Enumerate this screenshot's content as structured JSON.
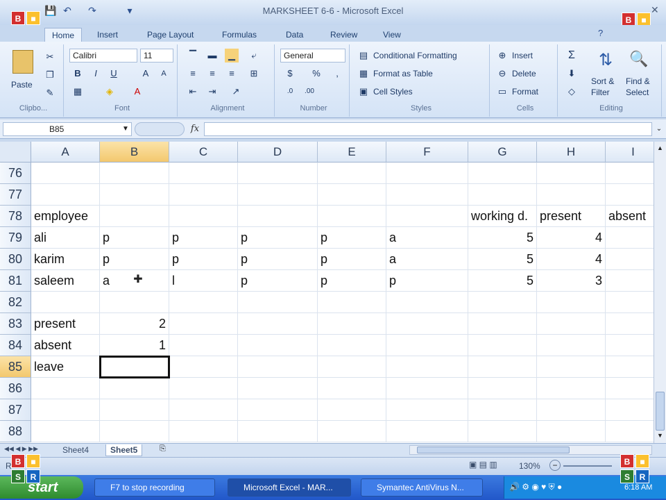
{
  "window": {
    "title": "MARKSHEET 6-6 - Microsoft Excel"
  },
  "ribbon_tabs": [
    "Home",
    "Insert",
    "Page Layout",
    "Formulas",
    "Data",
    "Review",
    "View"
  ],
  "ribbon": {
    "clipboard": {
      "paste": "Paste",
      "group": "Clipbo..."
    },
    "font": {
      "name": "Calibri",
      "size": "11",
      "group": "Font",
      "bold": "B",
      "italic": "I",
      "underline": "U"
    },
    "alignment": {
      "group": "Alignment"
    },
    "number": {
      "format": "General",
      "group": "Number",
      "currency": "$",
      "percent": "%"
    },
    "styles": {
      "conditional": "Conditional Formatting",
      "table": "Format as Table",
      "cell": "Cell Styles",
      "group": "Styles"
    },
    "cells": {
      "insert": "Insert",
      "delete": "Delete",
      "format": "Format",
      "group": "Cells"
    },
    "editing": {
      "sigma": "Σ",
      "sort": "Sort &",
      "sort2": "Filter",
      "find": "Find &",
      "find2": "Select",
      "group": "Editing"
    }
  },
  "formula_bar": {
    "name_box": "B85",
    "fx": "fx",
    "formula": ""
  },
  "columns": [
    "A",
    "B",
    "C",
    "D",
    "E",
    "F",
    "G",
    "H",
    "I"
  ],
  "selected_column": "B",
  "selected_row": "85",
  "rows": [
    {
      "num": "76",
      "cells": [
        "",
        "",
        "",
        "",
        "",
        "",
        "",
        "",
        ""
      ]
    },
    {
      "num": "77",
      "cells": [
        "",
        "",
        "",
        "",
        "",
        "",
        "",
        "",
        ""
      ]
    },
    {
      "num": "78",
      "cells": [
        "employee",
        "",
        "",
        "",
        "",
        "",
        "working d.",
        "present",
        "absent"
      ]
    },
    {
      "num": "79",
      "cells": [
        "ali",
        "p",
        "p",
        "p",
        "p",
        "a",
        "5",
        "4",
        ""
      ]
    },
    {
      "num": "80",
      "cells": [
        "karim",
        "p",
        "p",
        "p",
        "p",
        "a",
        "5",
        "4",
        ""
      ]
    },
    {
      "num": "81",
      "cells": [
        "saleem",
        "a",
        "l",
        "p",
        "p",
        "p",
        "5",
        "3",
        ""
      ]
    },
    {
      "num": "82",
      "cells": [
        "",
        "",
        "",
        "",
        "",
        "",
        "",
        "",
        ""
      ]
    },
    {
      "num": "83",
      "cells": [
        "present",
        "2",
        "",
        "",
        "",
        "",
        "",
        "",
        ""
      ]
    },
    {
      "num": "84",
      "cells": [
        "absent",
        "1",
        "",
        "",
        "",
        "",
        "",
        "",
        ""
      ]
    },
    {
      "num": "85",
      "cells": [
        "leave",
        "",
        "",
        "",
        "",
        "",
        "",
        "",
        ""
      ]
    },
    {
      "num": "86",
      "cells": [
        "",
        "",
        "",
        "",
        "",
        "",
        "",
        "",
        ""
      ]
    },
    {
      "num": "87",
      "cells": [
        "",
        "",
        "",
        "",
        "",
        "",
        "",
        "",
        ""
      ]
    },
    {
      "num": "88",
      "cells": [
        "",
        "",
        "",
        "",
        "",
        "",
        "",
        "",
        ""
      ]
    }
  ],
  "sheet_tabs": [
    "Sheet4",
    "Sheet5"
  ],
  "active_sheet": "Sheet5",
  "status": {
    "ready": "R",
    "zoom": "130%"
  },
  "taskbar": {
    "start": "start",
    "tasks": [
      "F7 to stop recording",
      "Microsoft Excel - MAR...",
      "Symantec AntiVirus N..."
    ],
    "clock": "6:18 AM"
  },
  "colors": {
    "selection_header": "#f3c86e",
    "taskbar": "#2157c9",
    "start": "#2e8b2e"
  }
}
